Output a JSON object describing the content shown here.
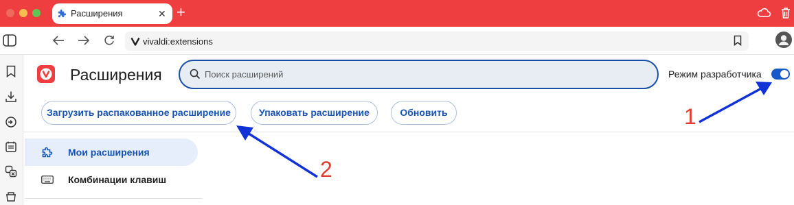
{
  "browser": {
    "tab": {
      "title": "Расширения"
    },
    "address": {
      "url": "vivaldi:extensions"
    }
  },
  "page": {
    "title": "Расширения",
    "search": {
      "placeholder": "Поиск расширений"
    },
    "developer_mode": {
      "label": "Режим разработчика",
      "enabled": true
    },
    "buttons": {
      "load_unpacked": "Загрузить распакованное расширение",
      "pack": "Упаковать расширение",
      "update": "Обновить"
    },
    "nav": {
      "my_extensions": "Мои расширения",
      "shortcuts": "Комбинации клавиш"
    }
  },
  "annotations": [
    {
      "number": "1"
    },
    {
      "number": "2"
    }
  ],
  "colors": {
    "titlebar": "#ef3e3f",
    "accent": "#1553b4",
    "toggle": "#1659c7",
    "annotation_arrow": "#1132d6",
    "annotation_number": "#e23b30"
  }
}
